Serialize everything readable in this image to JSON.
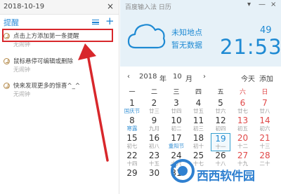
{
  "left": {
    "date": "2018-10-19",
    "close": "×",
    "title": "提醒",
    "add": "+",
    "items": [
      {
        "text": "点击上方添加第一条提醒",
        "sub": "无闹钟"
      },
      {
        "text": "鼠标悬停可编辑或删除",
        "sub": "无闹钟"
      },
      {
        "text": "快来发现更多的惊喜^_^",
        "sub": "无闹钟"
      }
    ]
  },
  "right": {
    "app_title": "百度输入法 日历",
    "window_controls": [
      "▾",
      "—",
      "×"
    ],
    "weather": {
      "location": "未知地点",
      "status": "暂无数据",
      "temperature": "49"
    },
    "clock": "21:53",
    "nav": {
      "prev": "‹",
      "year": "2018",
      "year_unit": "年",
      "month": "10",
      "month_unit": "月",
      "next": "›",
      "today": "今天",
      "add": "添加"
    },
    "weekdays": [
      "一",
      "二",
      "三",
      "四",
      "五",
      "六",
      "日"
    ],
    "weeks": [
      [
        [
          "1",
          "国庆节"
        ],
        [
          "2",
          "廿三"
        ],
        [
          "3",
          "廿四"
        ],
        [
          "4",
          "廿五"
        ],
        [
          "5",
          "廿六"
        ],
        [
          "6",
          "廿七"
        ],
        [
          "7",
          "廿八"
        ]
      ],
      [
        [
          "8",
          "寒露"
        ],
        [
          "9",
          "九月"
        ],
        [
          "10",
          "初二"
        ],
        [
          "11",
          "初三"
        ],
        [
          "12",
          "初四"
        ],
        [
          "13",
          "初五"
        ],
        [
          "14",
          "初六"
        ]
      ],
      [
        [
          "15",
          "初七"
        ],
        [
          "16",
          "初八"
        ],
        [
          "17",
          "重阳节"
        ],
        [
          "18",
          "初十"
        ],
        [
          "19",
          "十一"
        ],
        [
          "20",
          "十二"
        ],
        [
          "21",
          "十三"
        ]
      ],
      [
        [
          "22",
          "十四"
        ],
        [
          "23",
          "十五"
        ],
        [
          "24",
          "十六"
        ],
        [
          "25",
          "十七"
        ],
        [
          "26",
          "十八"
        ],
        [
          "27",
          "十九"
        ],
        [
          "28",
          "二十"
        ]
      ],
      [
        [
          "29",
          ""
        ],
        [
          "30",
          ""
        ],
        [
          "31",
          ""
        ],
        [
          "",
          ""
        ],
        [
          "",
          ""
        ],
        [
          "",
          ""
        ],
        [
          "",
          ""
        ]
      ]
    ],
    "selected_day": "19",
    "holidays": [
      "国庆节",
      "寒露",
      "重阳节"
    ],
    "accent": "#1f8ad3"
  },
  "watermark": {
    "text": "西西软件园"
  }
}
